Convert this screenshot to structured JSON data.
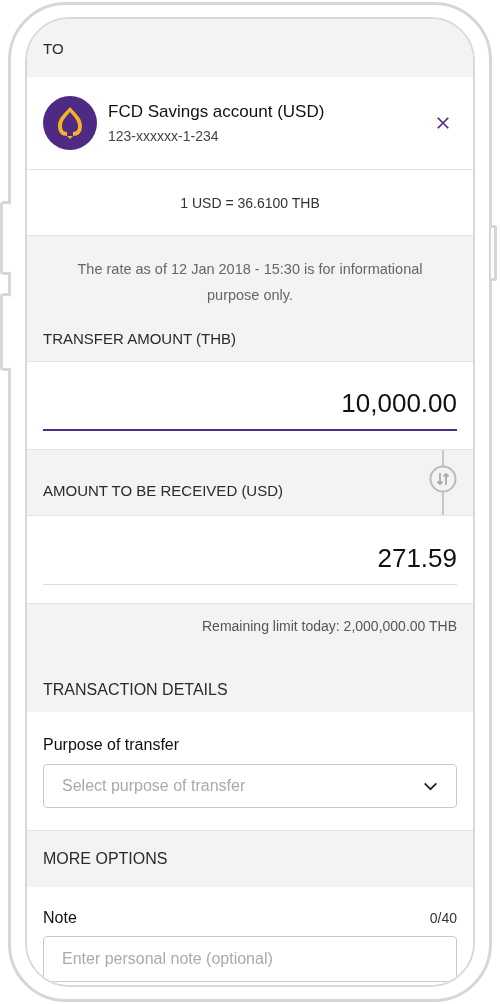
{
  "recipient": {
    "header": "TO",
    "name": "FCD Savings account (USD)",
    "account_number": "123-xxxxxx-1-234"
  },
  "exchange_rate": "1 USD = 36.6100 THB",
  "rate_note": "The rate as of 12 Jan 2018 - 15:30 is for informational purpose only.",
  "transfer_amount": {
    "label": "TRANSFER AMOUNT (THB)",
    "value": "10,000.00",
    "focused": true
  },
  "received_amount": {
    "label": "AMOUNT TO BE RECEIVED (USD)",
    "value": "271.59",
    "focused": false
  },
  "remaining_limit": "Remaining limit today: 2,000,000.00 THB",
  "transaction_details": {
    "header": "TRANSACTION DETAILS",
    "purpose_label": "Purpose of transfer",
    "purpose_placeholder": "Select purpose of transfer"
  },
  "more_options": {
    "header": "MORE OPTIONS",
    "note_label": "Note",
    "note_counter": "0/40",
    "note_placeholder": "Enter personal note (optional)"
  }
}
